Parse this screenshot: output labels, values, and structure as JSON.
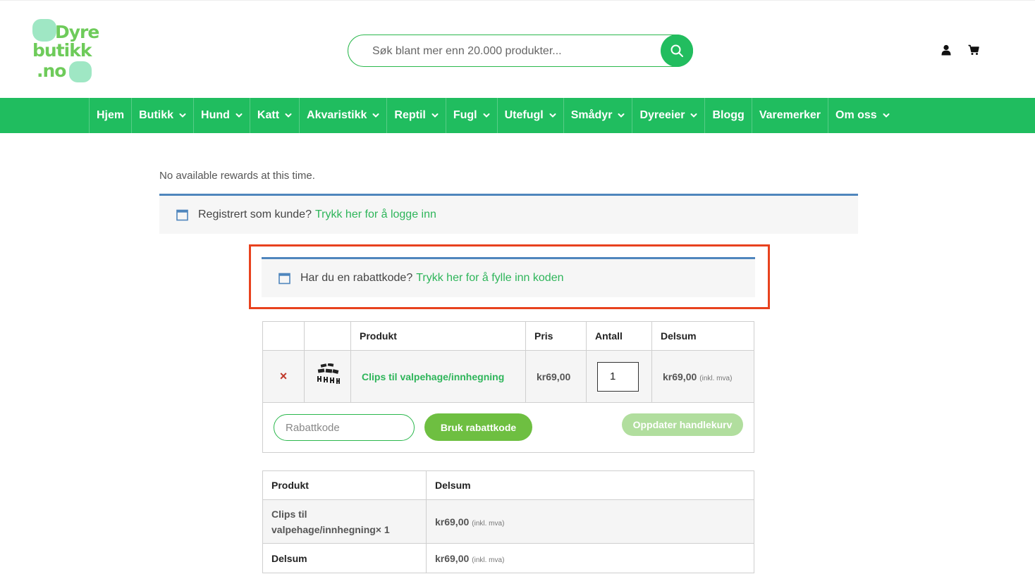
{
  "brand": {
    "logo_line1": "Dyre",
    "logo_line2": "butikk",
    "logo_line3": ".no",
    "accent_color": "#20bd5f"
  },
  "search": {
    "placeholder": "Søk blant mer enn 20.000 produkter...",
    "icon": "search-icon"
  },
  "header_icons": [
    "user-icon",
    "cart-icon"
  ],
  "nav": {
    "items": [
      {
        "label": "Hjem",
        "dropdown": false
      },
      {
        "label": "Butikk",
        "dropdown": true
      },
      {
        "label": "Hund",
        "dropdown": true
      },
      {
        "label": "Katt",
        "dropdown": true
      },
      {
        "label": "Akvaristikk",
        "dropdown": true
      },
      {
        "label": "Reptil",
        "dropdown": true
      },
      {
        "label": "Fugl",
        "dropdown": true
      },
      {
        "label": "Utefugl",
        "dropdown": true
      },
      {
        "label": "Smådyr",
        "dropdown": true
      },
      {
        "label": "Dyreeier",
        "dropdown": true
      },
      {
        "label": "Blogg",
        "dropdown": false
      },
      {
        "label": "Varemerker",
        "dropdown": false
      },
      {
        "label": "Om oss",
        "dropdown": true
      }
    ]
  },
  "rewards": {
    "text": "No available rewards at this time."
  },
  "login_notice": {
    "text": "Registrert som kunde?",
    "link": "Trykk her for å logge inn"
  },
  "coupon_notice": {
    "text": "Har du en rabattkode?",
    "link": "Trykk her for å fylle inn koden",
    "highlight_color": "#e8421e"
  },
  "cart": {
    "headers": [
      "",
      "",
      "Produkt",
      "Pris",
      "Antall",
      "Delsum"
    ],
    "items": [
      {
        "remove": "×",
        "name": "Clips til valpehage/innhegning",
        "price": "kr69,00",
        "quantity": "1",
        "subtotal": "kr69,00",
        "subtotal_note": "(inkl. mva)"
      }
    ],
    "coupon_placeholder": "Rabattkode",
    "apply_label": "Bruk rabattkode",
    "update_label": "Oppdater handlekurv"
  },
  "order_review": {
    "headers": [
      "Produkt",
      "Delsum"
    ],
    "item_name": "Clips til valpehage/innhegning",
    "item_qty": "× 1",
    "item_total": "kr69,00",
    "item_total_note": "(inkl. mva)",
    "subtotal_label": "Delsum",
    "subtotal_value": "kr69,00",
    "subtotal_note": "(inkl. mva)"
  }
}
